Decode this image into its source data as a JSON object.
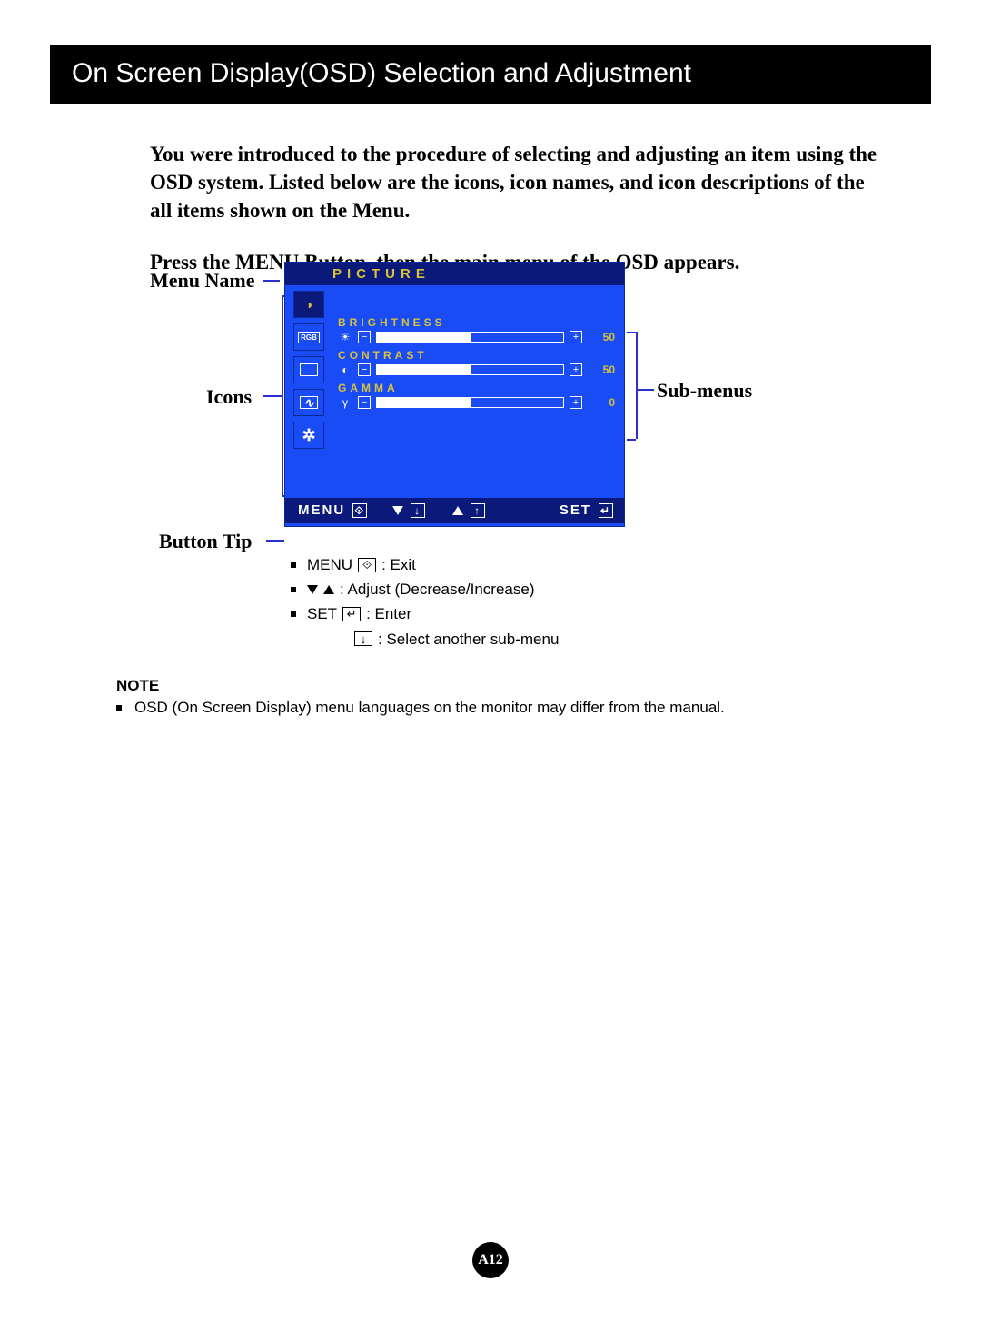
{
  "title_bar": "On Screen Display(OSD) Selection and Adjustment",
  "intro": {
    "p1": "You were introduced to the procedure of selecting and adjusting an item using the OSD system.  Listed below are the icons, icon names, and icon descriptions of the all items shown on the Menu.",
    "p2": "Press the MENU Button, then the main menu of the OSD appears."
  },
  "callouts": {
    "menu_name": "Menu Name",
    "icons": "Icons",
    "button_tip": "Button Tip",
    "sub_menus": "Sub-menus"
  },
  "osd": {
    "title": "PICTURE",
    "icon_column": [
      "picture",
      "rgb",
      "screen",
      "wave",
      "gear"
    ],
    "submenus": [
      {
        "label": "BRIGHTNESS",
        "icon": "☀",
        "value": 50,
        "fill_pct": 50
      },
      {
        "label": "CONTRAST",
        "icon": "◐",
        "value": 50,
        "fill_pct": 50
      },
      {
        "label": "GAMMA",
        "icon": "γ",
        "value": 0,
        "fill_pct": 50
      }
    ],
    "footer": {
      "menu": "MENU",
      "set": "SET"
    }
  },
  "tips": {
    "menu_exit": {
      "label": "MENU",
      "desc": ": Exit"
    },
    "adjust": ": Adjust (Decrease/Increase)",
    "set_enter": {
      "label": "SET",
      "desc": ": Enter"
    },
    "select_sub": ": Select another sub-menu"
  },
  "note": {
    "heading": "NOTE",
    "text": "OSD (On Screen Display) menu languages on the monitor may differ from the manual."
  },
  "page_number": "A12"
}
